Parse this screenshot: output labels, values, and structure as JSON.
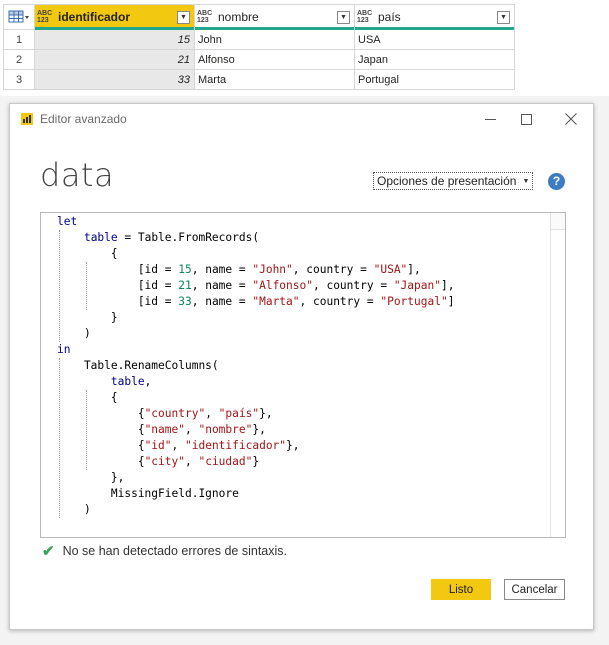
{
  "grid": {
    "columns": [
      {
        "type": "ABC\n123",
        "name": "identificador",
        "selected": true
      },
      {
        "type": "ABC\n123",
        "name": "nombre",
        "selected": false
      },
      {
        "type": "ABC\n123",
        "name": "país",
        "selected": false
      }
    ],
    "rows": [
      {
        "num": "1",
        "id": "15",
        "name": "John",
        "pais": "USA"
      },
      {
        "num": "2",
        "id": "21",
        "name": "Alfonso",
        "pais": "Japan"
      },
      {
        "num": "3",
        "id": "33",
        "name": "Marta",
        "pais": "Portugal"
      }
    ]
  },
  "dialog": {
    "title": "Editor avanzado",
    "heading": "data",
    "options_label": "Opciones de presentación",
    "help_icon": "?",
    "code_lines": [
      [
        {
          "t": "let",
          "c": "kw"
        }
      ],
      [
        {
          "t": "    "
        },
        {
          "t": "table",
          "c": "kw"
        },
        {
          "t": " = Table.FromRecords("
        }
      ],
      [
        {
          "t": "        {"
        }
      ],
      [
        {
          "t": "            [id = "
        },
        {
          "t": "15",
          "c": "num"
        },
        {
          "t": ", name = "
        },
        {
          "t": "\"John\"",
          "c": "str"
        },
        {
          "t": ", country = "
        },
        {
          "t": "\"USA\"",
          "c": "str"
        },
        {
          "t": "],"
        }
      ],
      [
        {
          "t": "            [id = "
        },
        {
          "t": "21",
          "c": "num"
        },
        {
          "t": ", name = "
        },
        {
          "t": "\"Alfonso\"",
          "c": "str"
        },
        {
          "t": ", country = "
        },
        {
          "t": "\"Japan\"",
          "c": "str"
        },
        {
          "t": "],"
        }
      ],
      [
        {
          "t": "            [id = "
        },
        {
          "t": "33",
          "c": "num"
        },
        {
          "t": ", name = "
        },
        {
          "t": "\"Marta\"",
          "c": "str"
        },
        {
          "t": ", country = "
        },
        {
          "t": "\"Portugal\"",
          "c": "str"
        },
        {
          "t": "]"
        }
      ],
      [
        {
          "t": "        }"
        }
      ],
      [
        {
          "t": "    )"
        }
      ],
      [
        {
          "t": "in",
          "c": "kw"
        }
      ],
      [
        {
          "t": "    Table.RenameColumns("
        }
      ],
      [
        {
          "t": "        "
        },
        {
          "t": "table",
          "c": "kw"
        },
        {
          "t": ","
        }
      ],
      [
        {
          "t": "        {"
        }
      ],
      [
        {
          "t": "            {"
        },
        {
          "t": "\"country\"",
          "c": "str"
        },
        {
          "t": ", "
        },
        {
          "t": "\"país\"",
          "c": "str"
        },
        {
          "t": "},"
        }
      ],
      [
        {
          "t": "            {"
        },
        {
          "t": "\"name\"",
          "c": "str"
        },
        {
          "t": ", "
        },
        {
          "t": "\"nombre\"",
          "c": "str"
        },
        {
          "t": "},"
        }
      ],
      [
        {
          "t": "            {"
        },
        {
          "t": "\"id\"",
          "c": "str"
        },
        {
          "t": ", "
        },
        {
          "t": "\"identificador\"",
          "c": "str"
        },
        {
          "t": "},"
        }
      ],
      [
        {
          "t": "            {"
        },
        {
          "t": "\"city\"",
          "c": "str"
        },
        {
          "t": ", "
        },
        {
          "t": "\"ciudad\"",
          "c": "str"
        },
        {
          "t": "}"
        }
      ],
      [
        {
          "t": "        },"
        }
      ],
      [
        {
          "t": "        MissingField.Ignore"
        }
      ],
      [
        {
          "t": "    )"
        }
      ]
    ],
    "status_text": "No se han detectado errores de sintaxis.",
    "ok_label": "Listo",
    "cancel_label": "Cancelar"
  },
  "colors": {
    "accent": "#f2c811",
    "column_bar": "#21a58b",
    "keyword": "#00008b",
    "string": "#a31515",
    "number": "#09885a",
    "check": "#3aa35b",
    "help": "#3c7cc4"
  },
  "icons": [
    "table-icon",
    "chevron-down-icon",
    "power-bi-icon",
    "minimize-icon",
    "maximize-icon",
    "close-icon",
    "help-icon",
    "check-icon"
  ]
}
